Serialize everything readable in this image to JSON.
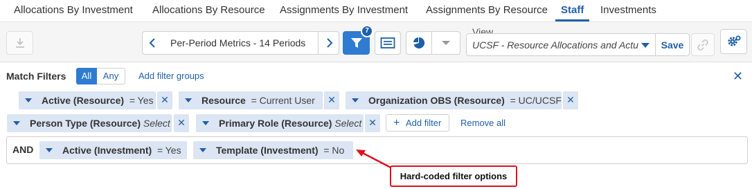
{
  "tabs": [
    {
      "label": "Allocations By Investment",
      "active": false
    },
    {
      "label": "Allocations By Resource",
      "active": false
    },
    {
      "label": "Assignments By Investment",
      "active": false
    },
    {
      "label": "Assignments By Resource",
      "active": false
    },
    {
      "label": "Staff",
      "active": true
    },
    {
      "label": "Investments",
      "active": false
    }
  ],
  "toolbar": {
    "period_label": "Per-Period Metrics - 14 Periods",
    "filter_count": "7",
    "view_label": "View",
    "view_value": "UCSF - Resource Allocations and Actu...",
    "save_label": "Save"
  },
  "filters": {
    "match_label": "Match Filters",
    "all_label": "All",
    "any_label": "Any",
    "add_group_label": "Add filter groups",
    "chips_row1": [
      {
        "field": "Active (Resource)",
        "value": "= Yes"
      },
      {
        "field": "Resource",
        "value": "= Current User"
      },
      {
        "field": "Organization OBS (Resource)",
        "value": "= UC/UCSF"
      }
    ],
    "chips_row2": [
      {
        "field": "Person Type (Resource)",
        "value": "Select"
      },
      {
        "field": "Primary Role (Resource)",
        "value": "Select"
      }
    ],
    "add_filter_label": "Add filter",
    "remove_all_label": "Remove all",
    "and_label": "AND",
    "and_chips": [
      {
        "field": "Active (Investment)",
        "value": "= Yes"
      },
      {
        "field": "Template (Investment)",
        "value": "= No"
      }
    ]
  },
  "annotation": {
    "text": "Hard-coded filter options",
    "color": "#e0101a"
  },
  "colors": {
    "accent": "#1f5fa8",
    "button_blue": "#2e7bd1",
    "chip_bg": "#dbe5f3"
  },
  "icons": [
    "download-icon",
    "chevron-left-icon",
    "chevron-right-icon",
    "filter-icon",
    "list-view-icon",
    "pie-chart-icon",
    "caret-down-icon",
    "link-icon",
    "settings-gear-icon",
    "close-icon",
    "plus-icon"
  ]
}
